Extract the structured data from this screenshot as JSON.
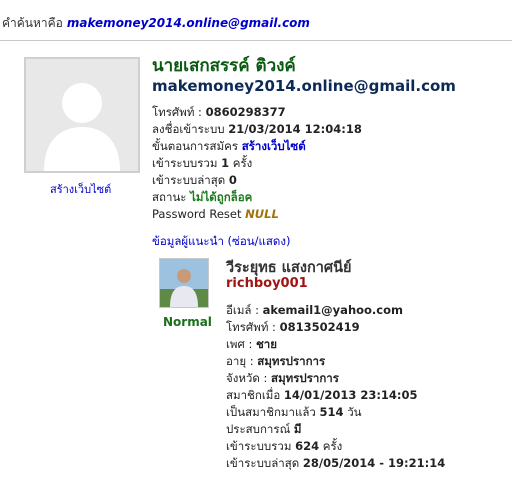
{
  "search": {
    "label": "คำค้นหาคือ",
    "query": "makemoney2014.online@gmail.com"
  },
  "member": {
    "name": "นายเสกสรรค์ ติวงค์",
    "email": "makemoney2014.online@gmail.com",
    "create_site_link": "สร้างเว็บไซต์",
    "fields": {
      "phone_label": "โทรศัพท์ :",
      "phone": "0860298377",
      "registered_label": "ลงชื่อเข้าระบบ",
      "registered": "21/03/2014 12:04:18",
      "step_label": "ขั้นตอนการสมัคร",
      "step": "สร้างเว็บไซต์",
      "total_logins_label": "เข้าระบบรวม",
      "total_logins": "1",
      "total_logins_unit": "ครั้ง",
      "last_login_label": "เข้าระบบล่าสุด",
      "last_login": "0",
      "status_label": "สถานะ",
      "status": "ไม่ได้ถูกล็อค",
      "password_reset_label": "Password Reset",
      "password_reset": "NULL"
    },
    "referrer_toggle": "ข้อมูลผู้แนะนำ (ซ่อน/แสดง)"
  },
  "referrer": {
    "name": "วีระยุทธ แสงกาศนีย์",
    "username": "richboy001",
    "level": "Normal",
    "fields": {
      "email_label": "อีเมล์ :",
      "email": "akemail1@yahoo.com",
      "phone_label": "โทรศัพท์ :",
      "phone": "0813502419",
      "gender_label": "เพศ :",
      "gender": "ชาย",
      "district_label": "อายุ :",
      "district": "สมุทรปราการ",
      "province_label": "จังหวัด :",
      "province": "สมุทรปราการ",
      "joined_label": "สมาชิกเมื่อ",
      "joined": "14/01/2013 23:14:05",
      "member_days_label": "เป็นสมาชิกมาแล้ว",
      "member_days": "514",
      "member_days_unit": "วัน",
      "experience_label": "ประสบการณ์",
      "experience": "มี",
      "total_logins_label": "เข้าระบบรวม",
      "total_logins": "624",
      "total_logins_unit": "ครั้ง",
      "last_login_label": "เข้าระบบล่าสุด",
      "last_login": "28/05/2014 - 19:21:14"
    }
  }
}
